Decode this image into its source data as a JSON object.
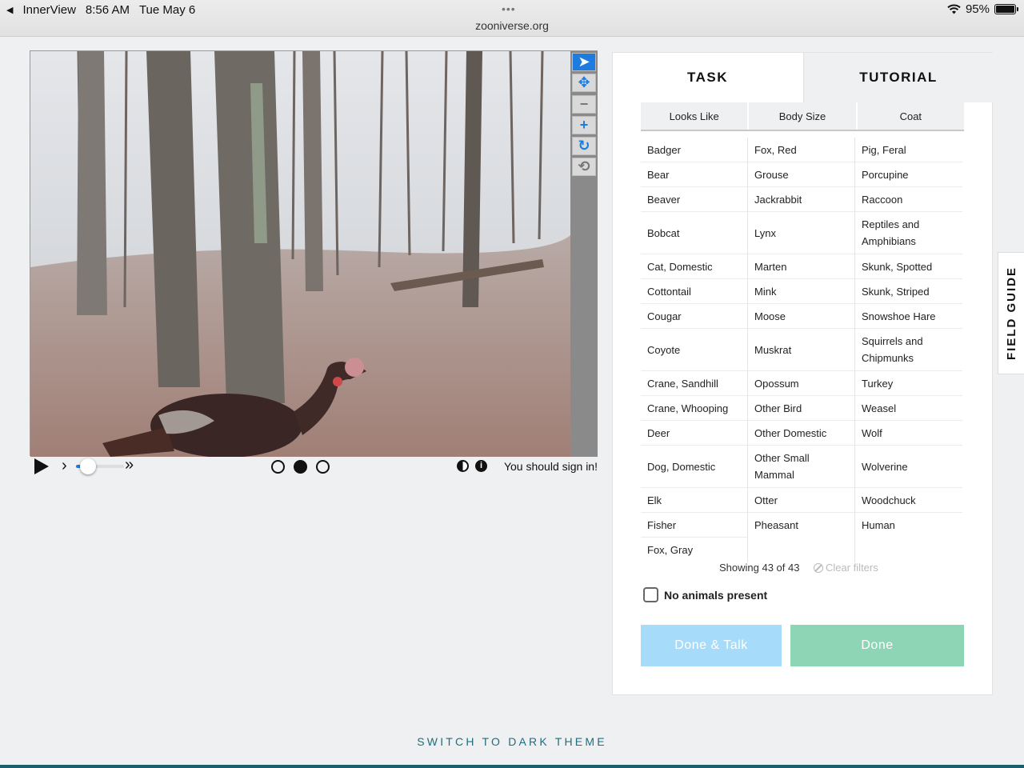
{
  "status_bar": {
    "back_app": "InnerView",
    "time": "8:56 AM",
    "date": "Tue May 6",
    "url": "zooniverse.org",
    "battery": "95%"
  },
  "viewer": {
    "tools": [
      "pointer-icon",
      "move-icon",
      "zoom-out-icon",
      "zoom-in-icon",
      "rotate-icon",
      "reset-icon"
    ],
    "frames": 3,
    "active_frame": 2,
    "sign_in_message": "You should sign in!"
  },
  "task_panel": {
    "tabs": [
      {
        "label": "TASK",
        "active": true
      },
      {
        "label": "TUTORIAL",
        "active": false
      }
    ],
    "filters": [
      "Looks Like",
      "Body Size",
      "Coat"
    ],
    "choices_col1": [
      "Badger",
      "Bear",
      "Beaver",
      "Bobcat",
      "Cat, Domestic",
      "Cottontail",
      "Cougar",
      "Coyote",
      "Crane, Sandhill",
      "Crane, Whooping",
      "Deer",
      "Dog, Domestic",
      "Elk",
      "Fisher",
      "Fox, Gray"
    ],
    "choices_col2": [
      "Fox, Red",
      "Grouse",
      "Jackrabbit",
      "Lynx",
      "Marten",
      "Mink",
      "Moose",
      "Muskrat",
      "Opossum",
      "Other Bird",
      "Other Domestic",
      "Other Small Mammal",
      "Otter",
      "Pheasant"
    ],
    "choices_col3": [
      "Pig, Feral",
      "Porcupine",
      "Raccoon",
      "Reptiles and Amphibians",
      "Skunk, Spotted",
      "Skunk, Striped",
      "Snowshoe Hare",
      "Squirrels and Chipmunks",
      "Turkey",
      "Weasel",
      "Wolf",
      "Wolverine",
      "Woodchuck",
      "Human"
    ],
    "showing": "Showing 43 of 43",
    "clear_filters": "Clear filters",
    "no_animals_label": "No animals present",
    "done_talk_label": "Done & Talk",
    "done_label": "Done"
  },
  "field_guide_label": "FIELD GUIDE",
  "dark_theme_label": "SWITCH TO DARK THEME",
  "colors": {
    "accent_blue": "#1e7be0",
    "done_talk_bg": "#a6dbfa",
    "done_bg": "#8dd5b4",
    "dark_theme_text": "#1e6e7e"
  }
}
